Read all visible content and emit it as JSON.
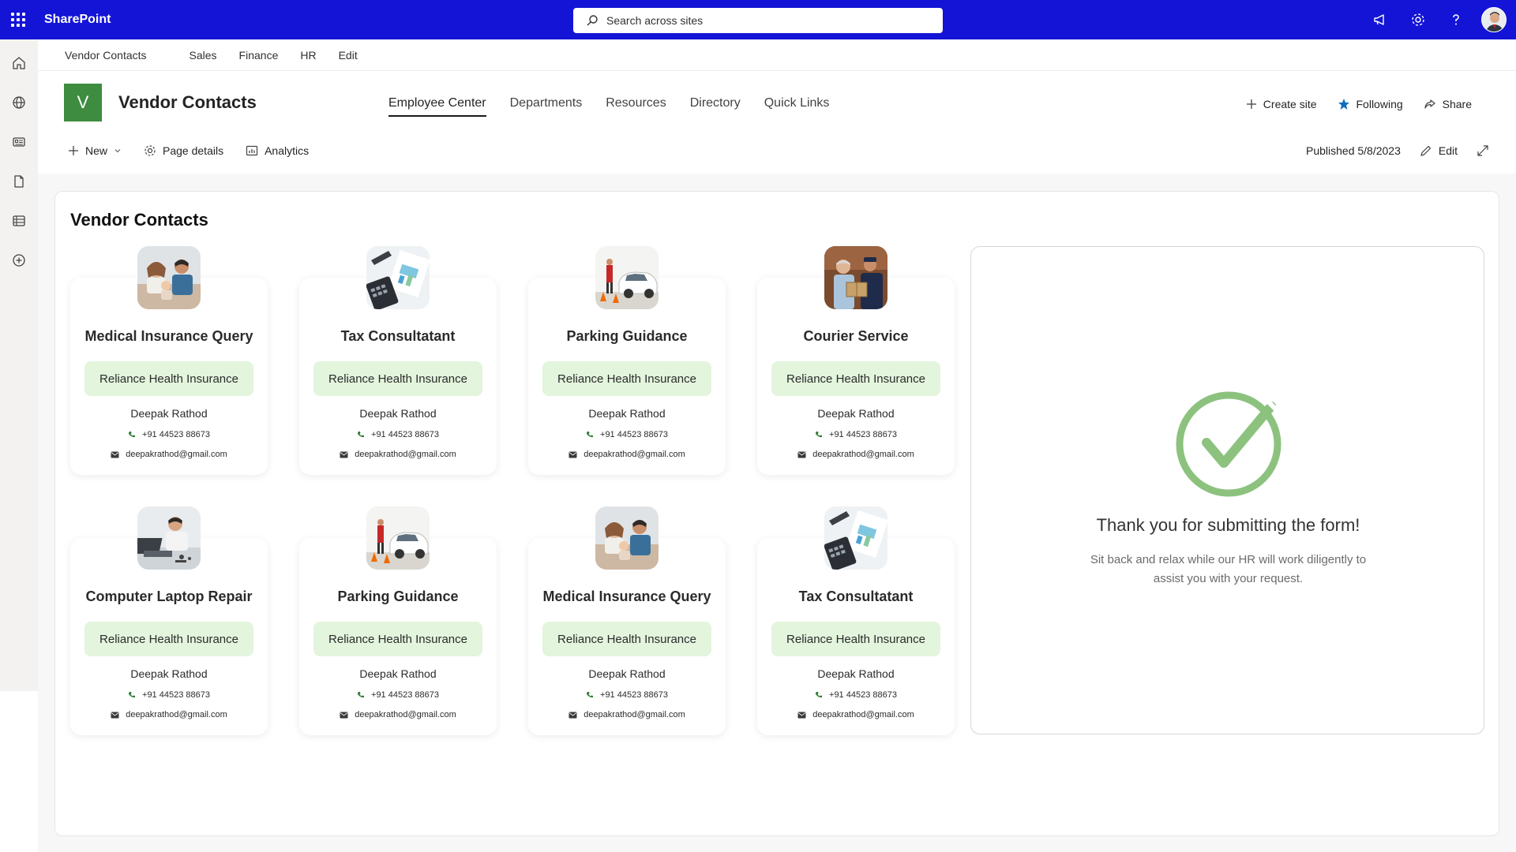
{
  "suite": {
    "brand": "SharePoint",
    "search_placeholder": "Search across sites",
    "icons": [
      "waffle-icon",
      "megaphone-icon",
      "gear-icon",
      "help-icon",
      "avatar"
    ]
  },
  "hub": {
    "title": "Vendor Contacts",
    "links": [
      "Sales",
      "Finance",
      "HR",
      "Edit"
    ]
  },
  "site": {
    "logo_letter": "V",
    "logo_color": "#3d8c40",
    "title": "Vendor Contacts",
    "nav": [
      "Employee Center",
      "Departments",
      "Resources",
      "Directory",
      "Quick Links"
    ],
    "active_nav": "Employee Center",
    "actions": {
      "create": "Create site",
      "following": "Following",
      "share": "Share"
    }
  },
  "commandbar": {
    "new": "New",
    "page_details": "Page details",
    "analytics": "Analytics",
    "published": "Published 5/8/2023",
    "edit": "Edit"
  },
  "section": {
    "title": "Vendor Contacts"
  },
  "cards": [
    {
      "title": "Medical Insurance Query",
      "company": "Reliance Health Insurance",
      "contact": "Deepak Rathod",
      "phone": "+91 44523 88673",
      "email": "deepakrathod@gmail.com",
      "photo": "family-photo"
    },
    {
      "title": "Tax Consultatant",
      "company": "Reliance Health Insurance",
      "contact": "Deepak Rathod",
      "phone": "+91 44523 88673",
      "email": "deepakrathod@gmail.com",
      "photo": "tax-photo"
    },
    {
      "title": "Parking Guidance",
      "company": "Reliance Health Insurance",
      "contact": "Deepak Rathod",
      "phone": "+91 44523 88673",
      "email": "deepakrathod@gmail.com",
      "photo": "parking-photo"
    },
    {
      "title": "Courier Service",
      "company": "Reliance Health Insurance",
      "contact": "Deepak Rathod",
      "phone": "+91 44523 88673",
      "email": "deepakrathod@gmail.com",
      "photo": "courier-photo"
    },
    {
      "title": "Computer Laptop Repair",
      "company": "Reliance Health Insurance",
      "contact": "Deepak Rathod",
      "phone": "+91 44523 88673",
      "email": "deepakrathod@gmail.com",
      "photo": "repair-photo"
    },
    {
      "title": "Parking Guidance",
      "company": "Reliance Health Insurance",
      "contact": "Deepak Rathod",
      "phone": "+91 44523 88673",
      "email": "deepakrathod@gmail.com",
      "photo": "parking-photo"
    },
    {
      "title": "Medical Insurance Query",
      "company": "Reliance Health Insurance",
      "contact": "Deepak Rathod",
      "phone": "+91 44523 88673",
      "email": "deepakrathod@gmail.com",
      "photo": "family-photo"
    },
    {
      "title": "Tax Consultatant",
      "company": "Reliance Health Insurance",
      "contact": "Deepak Rathod",
      "phone": "+91 44523 88673",
      "email": "deepakrathod@gmail.com",
      "photo": "tax-photo"
    }
  ],
  "confirmation": {
    "title": "Thank you for submitting the form!",
    "message": "Sit back and relax while our HR will work diligently to assist you with your request.",
    "icon": "checkmark-circle-icon",
    "accent": "#8cc27e"
  },
  "colors": {
    "suitebar": "#1414d6",
    "pill": "#e3f5dd",
    "accent_green": "#3d8c40"
  }
}
